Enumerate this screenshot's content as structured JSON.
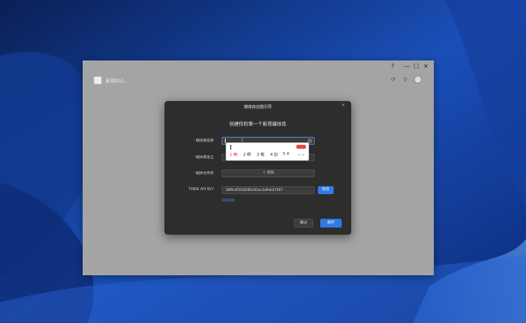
{
  "colors": {
    "accent": "#2f7ae5",
    "dialog_bg": "#2d2d2d",
    "window_bg": "#a4a4a4",
    "required": "#e05050"
  },
  "window": {
    "controls": {
      "help": "?",
      "minimize": "—",
      "maximize": "☐",
      "close": "✕"
    },
    "app_title": "影视中心",
    "header_icons": [
      "refresh-icon",
      "search-icon",
      "avatar"
    ]
  },
  "dialog": {
    "title": "媒体库创建引导",
    "heading": "创建你的第一个影视媒体库",
    "fields": {
      "name_label": "媒体库名称",
      "language_label": "媒体库语言",
      "folder_label": "媒体文件夹",
      "folder_add": "+ 添加",
      "api_label": "TMDB API KEY",
      "api_value": "38f9cd5918285c81ac2a9eb27467",
      "verify": "校验",
      "api_help": "如何获取"
    },
    "required_mark": "*",
    "buttons": {
      "skip": "跳过",
      "save": "保存"
    }
  },
  "ime": {
    "candidates": [
      "1 两",
      "2 啊",
      "3 嗯",
      "4 加",
      "5 4"
    ],
    "nav": "< >"
  }
}
